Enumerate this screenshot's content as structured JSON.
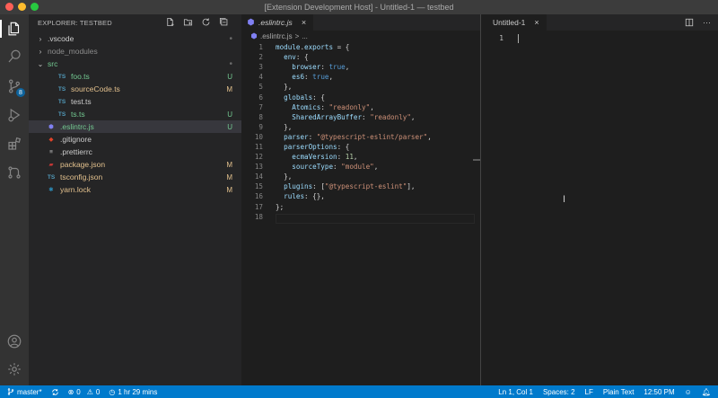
{
  "window": {
    "title": "[Extension Development Host] - Untitled-1 — testbed"
  },
  "activity_bar": {
    "scm_badge": "8"
  },
  "explorer": {
    "header": "EXPLORER: TESTBED",
    "items": [
      {
        "label": ".vscode",
        "type": "folder",
        "collapsed": true,
        "indent": 0,
        "color": "#cccccc",
        "status": "•"
      },
      {
        "label": "node_modules",
        "type": "folder",
        "collapsed": true,
        "indent": 0,
        "color": "#8c8c8c",
        "status": ""
      },
      {
        "label": "src",
        "type": "folder",
        "collapsed": false,
        "indent": 0,
        "color": "#73c991",
        "status": "•"
      },
      {
        "label": "foo.ts",
        "type": "ts",
        "indent": 1,
        "color": "#73c991",
        "status": "U"
      },
      {
        "label": "sourceCode.ts",
        "type": "ts",
        "indent": 1,
        "color": "#e2c08d",
        "status": "M"
      },
      {
        "label": "test.ts",
        "type": "ts",
        "indent": 1,
        "color": "#cccccc",
        "status": ""
      },
      {
        "label": "ts.ts",
        "type": "ts",
        "indent": 1,
        "color": "#73c991",
        "status": "U"
      },
      {
        "label": ".eslintrc.js",
        "type": "eslint",
        "indent": 0,
        "color": "#73c991",
        "status": "U",
        "selected": true
      },
      {
        "label": ".gitignore",
        "type": "git",
        "indent": 0,
        "color": "#cccccc",
        "status": ""
      },
      {
        "label": ".prettierrc",
        "type": "prettier",
        "indent": 0,
        "color": "#cccccc",
        "status": ""
      },
      {
        "label": "package.json",
        "type": "npm",
        "indent": 0,
        "color": "#e2c08d",
        "status": "M"
      },
      {
        "label": "tsconfig.json",
        "type": "tsconfig",
        "indent": 0,
        "color": "#e2c08d",
        "status": "M"
      },
      {
        "label": "yarn.lock",
        "type": "yarn",
        "indent": 0,
        "color": "#e2c08d",
        "status": "M"
      }
    ]
  },
  "editor_left": {
    "tab_label": ".eslintrc.js",
    "breadcrumb_file": ".eslintrc.js",
    "breadcrumb_sep": ">",
    "breadcrumb_tail": "...",
    "lines": [
      [
        [
          "k",
          "module"
        ],
        [
          "p",
          "."
        ],
        [
          "k",
          "exports"
        ],
        [
          "p",
          " = {"
        ]
      ],
      [
        [
          "p",
          "  "
        ],
        [
          "k",
          "env"
        ],
        [
          "p",
          ": {"
        ]
      ],
      [
        [
          "p",
          "    "
        ],
        [
          "k",
          "browser"
        ],
        [
          "p",
          ": "
        ],
        [
          "b",
          "true"
        ],
        [
          "p",
          ","
        ]
      ],
      [
        [
          "p",
          "    "
        ],
        [
          "k",
          "es6"
        ],
        [
          "p",
          ": "
        ],
        [
          "b",
          "true"
        ],
        [
          "p",
          ","
        ]
      ],
      [
        [
          "p",
          "  },"
        ]
      ],
      [
        [
          "p",
          "  "
        ],
        [
          "k",
          "globals"
        ],
        [
          "p",
          ": {"
        ]
      ],
      [
        [
          "p",
          "    "
        ],
        [
          "k",
          "Atomics"
        ],
        [
          "p",
          ": "
        ],
        [
          "s",
          "\"readonly\""
        ],
        [
          "p",
          ","
        ]
      ],
      [
        [
          "p",
          "    "
        ],
        [
          "k",
          "SharedArrayBuffer"
        ],
        [
          "p",
          ": "
        ],
        [
          "s",
          "\"readonly\""
        ],
        [
          "p",
          ","
        ]
      ],
      [
        [
          "p",
          "  },"
        ]
      ],
      [
        [
          "p",
          "  "
        ],
        [
          "k",
          "parser"
        ],
        [
          "p",
          ": "
        ],
        [
          "s",
          "\"@typescript-eslint/parser\""
        ],
        [
          "p",
          ","
        ]
      ],
      [
        [
          "p",
          "  "
        ],
        [
          "k",
          "parserOptions"
        ],
        [
          "p",
          ": {"
        ]
      ],
      [
        [
          "p",
          "    "
        ],
        [
          "k",
          "ecmaVersion"
        ],
        [
          "p",
          ": "
        ],
        [
          "n",
          "11"
        ],
        [
          "p",
          ","
        ]
      ],
      [
        [
          "p",
          "    "
        ],
        [
          "k",
          "sourceType"
        ],
        [
          "p",
          ": "
        ],
        [
          "s",
          "\"module\""
        ],
        [
          "p",
          ","
        ]
      ],
      [
        [
          "p",
          "  },"
        ]
      ],
      [
        [
          "p",
          "  "
        ],
        [
          "k",
          "plugins"
        ],
        [
          "p",
          ": ["
        ],
        [
          "s",
          "\"@typescript-eslint\""
        ],
        [
          "p",
          "],"
        ]
      ],
      [
        [
          "p",
          "  "
        ],
        [
          "k",
          "rules"
        ],
        [
          "p",
          ": {},"
        ]
      ],
      [
        [
          "p",
          "};"
        ]
      ],
      [
        [
          "p",
          ""
        ]
      ]
    ]
  },
  "editor_right": {
    "tab_label": "Untitled-1",
    "line_number": "1"
  },
  "statusbar": {
    "branch": "master*",
    "errors": "0",
    "warnings": "0",
    "time": "1 hr 29 mins",
    "position": "Ln 1, Col 1",
    "spaces": "Spaces: 2",
    "eol": "LF",
    "language": "Plain Text",
    "clock": "12:50 PM"
  },
  "colors": {
    "accent": "#007acc",
    "untracked": "#73c991",
    "modified": "#e2c08d"
  }
}
